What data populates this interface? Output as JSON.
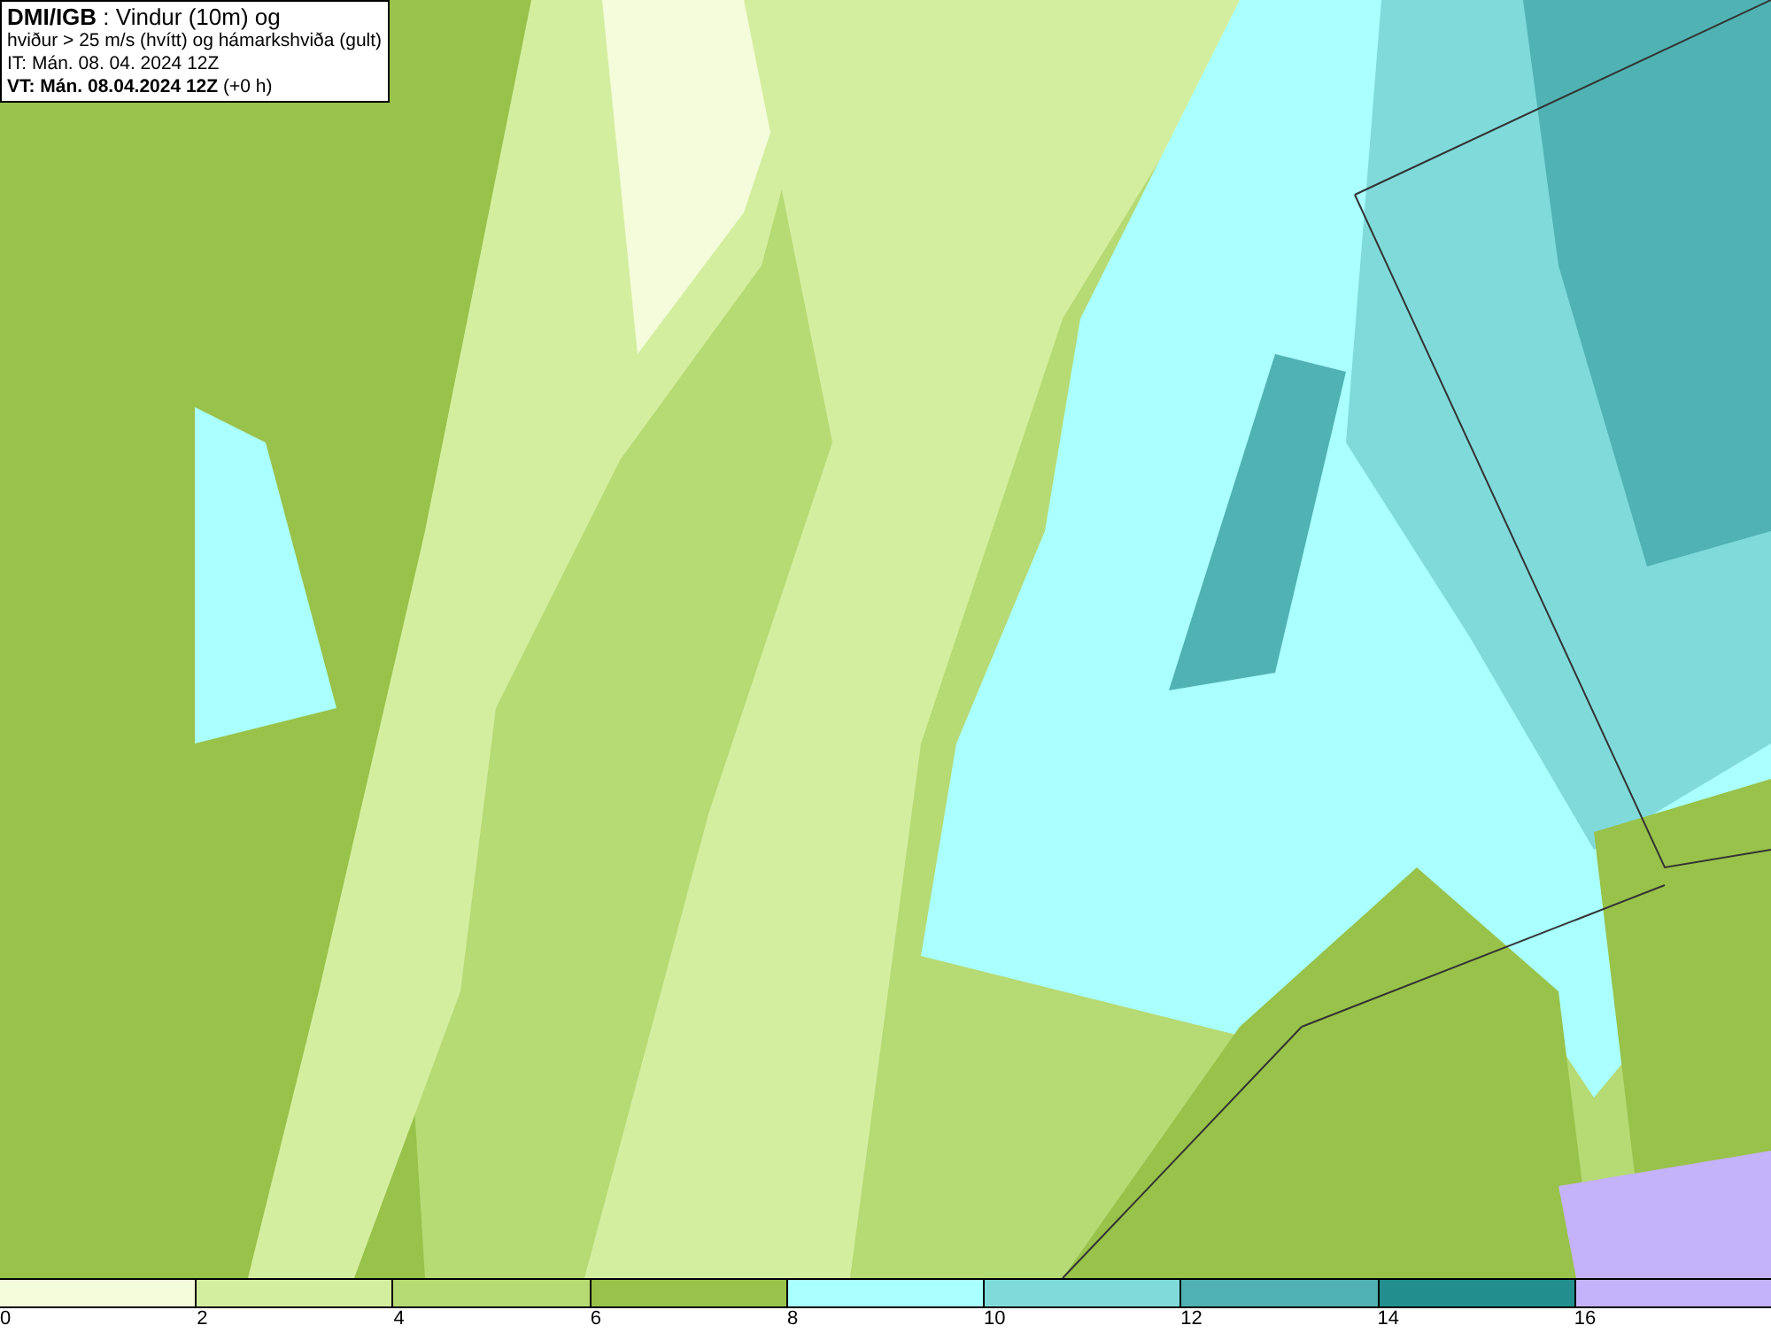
{
  "title_box": {
    "lines": [
      "**DMI/IGB** : Vindur (10m) og",
      "hviður > 25 m/s (hvítt) og hámarkshviða (gult)",
      "IT: Mán. 08. 04. 2024 12Z",
      "**VT: Mán. 08.04.2024 12Z** (+0 h)"
    ]
  },
  "legend": [
    {
      "color": "#f4fcdc",
      "label": "0"
    },
    {
      "color": "#d4eea0",
      "label": "2"
    },
    {
      "color": "#b6da74",
      "label": "4"
    },
    {
      "color": "#98c24a",
      "label": "6"
    },
    {
      "color": "#aaffff",
      "label": "8"
    },
    {
      "color": "#80dada",
      "label": "10"
    },
    {
      "color": "#50b2b2",
      "label": "12"
    },
    {
      "color": "#228e8e",
      "label": "14"
    },
    {
      "color": "#c4b2fa",
      "label": "16"
    }
  ]
}
